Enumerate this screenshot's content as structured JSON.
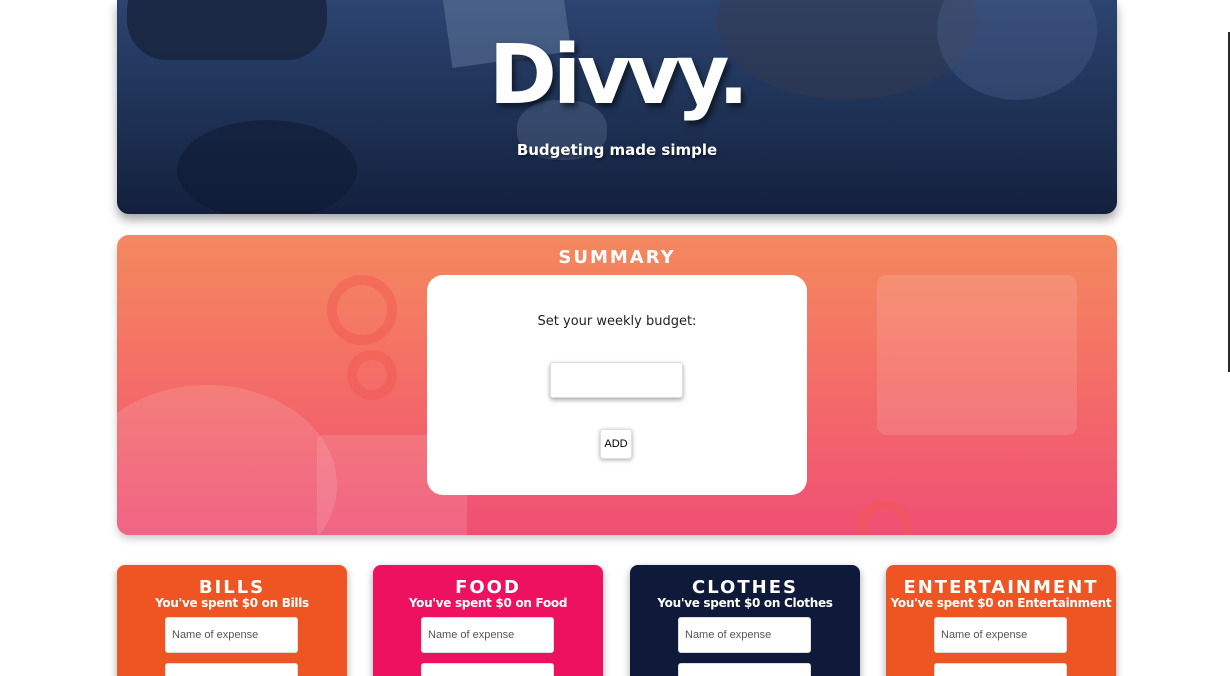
{
  "hero": {
    "logo_text": "Divvy.",
    "tagline": "Budgeting made simple"
  },
  "summary": {
    "title": "SUMMARY",
    "budget_label": "Set your weekly budget:",
    "budget_value": "",
    "add_label": "ADD"
  },
  "categories": [
    {
      "title": "BILLS",
      "spent_text": "You've spent $0 on Bills",
      "expense_placeholder": "Name of expense",
      "color": "#ef5522"
    },
    {
      "title": "FOOD",
      "spent_text": "You've spent $0 on Food",
      "expense_placeholder": "Name of expense",
      "color": "#ee1160"
    },
    {
      "title": "CLOTHES",
      "spent_text": "You've spent $0 on Clothes",
      "expense_placeholder": "Name of expense",
      "color": "#0f1a3a"
    },
    {
      "title": "ENTERTAINMENT",
      "spent_text": "You've spent $0 on Entertainment",
      "expense_placeholder": "Name of expense",
      "color": "#ef5522"
    }
  ]
}
